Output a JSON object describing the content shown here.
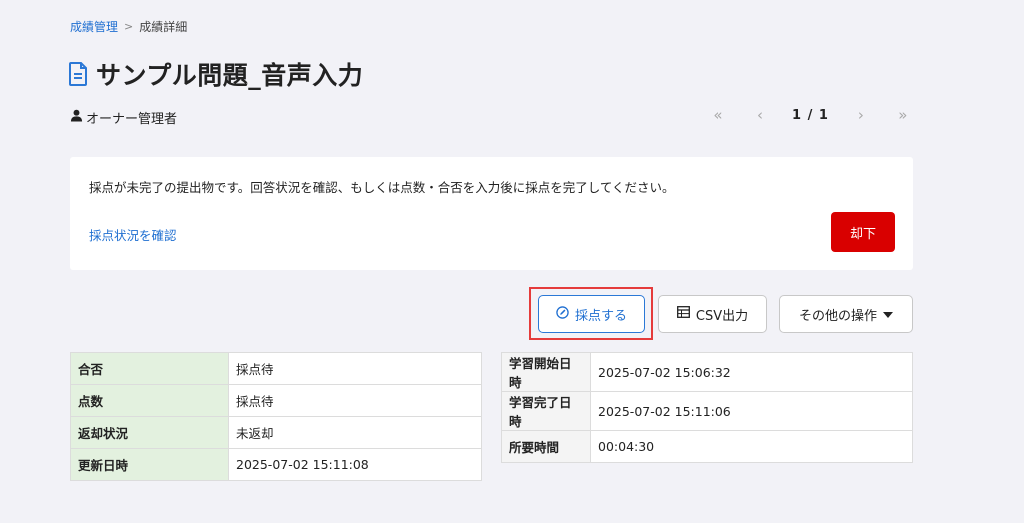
{
  "breadcrumb": {
    "parent": "成績管理",
    "current": "成績詳細"
  },
  "page": {
    "title": "サンプル問題_音声入力"
  },
  "owner": {
    "label": "オーナー管理者"
  },
  "pager": {
    "first": "«",
    "prev": "‹",
    "text": "1 / 1",
    "next": "›",
    "last": "»"
  },
  "notice": {
    "message": "採点が未完了の提出物です。回答状況を確認、もしくは点数・合否を入力後に採点を完了してください。",
    "check_link": "採点状況を確認",
    "reject_label": "却下"
  },
  "actions": {
    "grade": "採点する",
    "csv": "CSV出力",
    "other": "その他の操作"
  },
  "result_table": [
    {
      "key": "合否",
      "value": "採点待"
    },
    {
      "key": "点数",
      "value": "採点待"
    },
    {
      "key": "返却状況",
      "value": "未返却"
    },
    {
      "key": "更新日時",
      "value": "2025-07-02 15:11:08"
    }
  ],
  "time_table": [
    {
      "key": "学習開始日時",
      "value": "2025-07-02 15:06:32"
    },
    {
      "key": "学習完了日時",
      "value": "2025-07-02 15:11:06"
    },
    {
      "key": "所要時間",
      "value": "00:04:30"
    }
  ],
  "colors": {
    "link": "#1f6fd1",
    "reject": "#d90000",
    "highlight": "#e53b3b",
    "key_green": "#e3f1df"
  },
  "icons": {
    "title": "document-icon",
    "owner": "user-icon",
    "grade": "edit-icon",
    "csv": "table-icon",
    "other": "caret-down-icon"
  }
}
